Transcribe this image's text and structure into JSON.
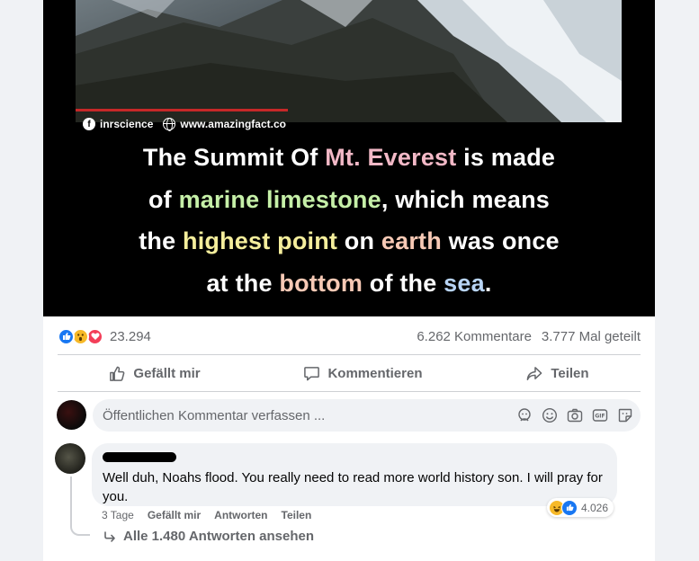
{
  "post": {
    "image": {
      "watermark_handle": "inrscience",
      "watermark_site": "www.amazingfact.co",
      "caption_lines": [
        [
          {
            "t": "The Summit Of ",
            "c": ""
          },
          {
            "t": "Mt. Everest",
            "c": "c-pink"
          },
          {
            "t": " is made",
            "c": ""
          }
        ],
        [
          {
            "t": "of ",
            "c": ""
          },
          {
            "t": "marine limestone",
            "c": "c-green"
          },
          {
            "t": ", which means",
            "c": ""
          }
        ],
        [
          {
            "t": "the ",
            "c": ""
          },
          {
            "t": "highest point",
            "c": "c-yellow"
          },
          {
            "t": " on ",
            "c": ""
          },
          {
            "t": "earth",
            "c": "c-peach"
          },
          {
            "t": " was once",
            "c": ""
          }
        ],
        [
          {
            "t": "at the ",
            "c": ""
          },
          {
            "t": "bottom",
            "c": "c-peach"
          },
          {
            "t": " of the ",
            "c": ""
          },
          {
            "t": "sea",
            "c": "c-blue"
          },
          {
            "t": ".",
            "c": ""
          }
        ]
      ]
    },
    "stats": {
      "reaction_icons": [
        "like-icon",
        "wow-icon",
        "love-icon"
      ],
      "reaction_count": "23.294",
      "comments": "6.262 Kommentare",
      "shares": "3.777 Mal geteilt"
    },
    "actions": {
      "like": "Gefällt mir",
      "comment": "Kommentieren",
      "share": "Teilen"
    },
    "composer": {
      "placeholder": "Öffentlichen Kommentar verfassen ...",
      "tools": [
        "avatar-sticker-icon",
        "emoji-icon",
        "camera-icon",
        "gif-icon",
        "sticker-icon"
      ]
    }
  },
  "comment": {
    "text": "Well duh, Noahs flood. You really need to read more world history son. I will pray for you.",
    "reaction_icons": [
      "haha-icon",
      "like-icon"
    ],
    "reaction_count": "4.026",
    "time": "3 Tage",
    "like": "Gefällt mir",
    "reply": "Antworten",
    "share": "Teilen",
    "view_replies": "Alle 1.480 Antworten ansehen"
  },
  "colors": {
    "accent_blue": "#1877f2",
    "text_secondary": "#65676b",
    "bubble_bg": "#f0f2f5"
  }
}
